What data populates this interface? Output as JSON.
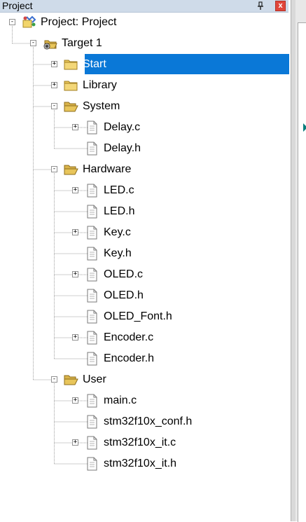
{
  "panel": {
    "title": "Project",
    "pin_glyph": "↕",
    "close_glyph": "x"
  },
  "tree": {
    "root": {
      "label": "Project: Project",
      "icon": "project-icon",
      "expanded": true
    },
    "target": {
      "label": "Target 1",
      "icon": "target-icon",
      "expanded": true
    },
    "groups": [
      {
        "label": "Start",
        "icon": "folder-closed-icon",
        "expanded": false,
        "selected": true,
        "files": []
      },
      {
        "label": "Library",
        "icon": "folder-closed-icon",
        "expanded": false,
        "selected": false,
        "files": []
      },
      {
        "label": "System",
        "icon": "folder-open-icon",
        "expanded": true,
        "selected": false,
        "files": [
          {
            "label": "Delay.c",
            "expandable": true
          },
          {
            "label": "Delay.h",
            "expandable": false
          }
        ]
      },
      {
        "label": "Hardware",
        "icon": "folder-open-icon",
        "expanded": true,
        "selected": false,
        "files": [
          {
            "label": "LED.c",
            "expandable": true
          },
          {
            "label": "LED.h",
            "expandable": false
          },
          {
            "label": "Key.c",
            "expandable": true
          },
          {
            "label": "Key.h",
            "expandable": false
          },
          {
            "label": "OLED.c",
            "expandable": true
          },
          {
            "label": "OLED.h",
            "expandable": false
          },
          {
            "label": "OLED_Font.h",
            "expandable": false
          },
          {
            "label": "Encoder.c",
            "expandable": true
          },
          {
            "label": "Encoder.h",
            "expandable": false
          }
        ]
      },
      {
        "label": "User",
        "icon": "folder-open-icon",
        "expanded": true,
        "selected": false,
        "files": [
          {
            "label": "main.c",
            "expandable": true
          },
          {
            "label": "stm32f10x_conf.h",
            "expandable": false
          },
          {
            "label": "stm32f10x_it.c",
            "expandable": true
          },
          {
            "label": "stm32f10x_it.h",
            "expandable": false
          }
        ]
      }
    ]
  },
  "colors": {
    "selection": "#0a78d7",
    "folder": "#e8c55a",
    "titlebar": "#cfdbe9",
    "close": "#e0463b"
  }
}
